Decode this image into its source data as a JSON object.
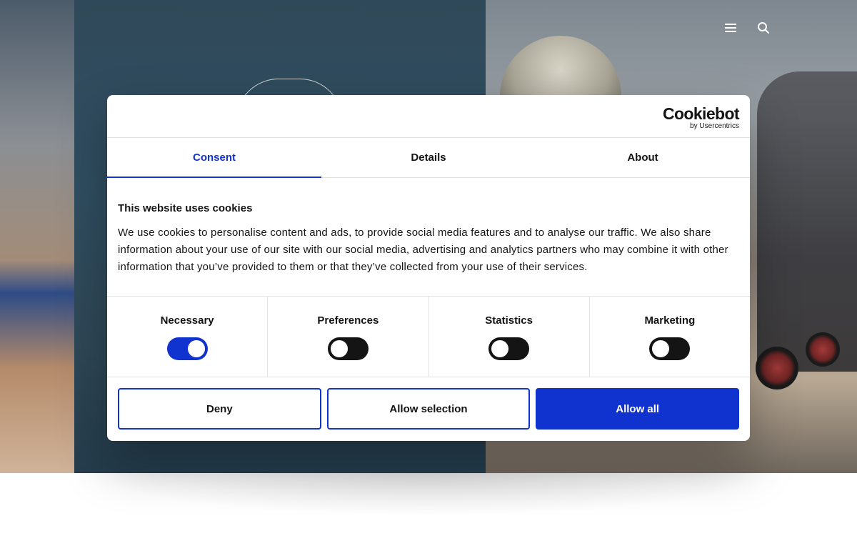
{
  "header": {
    "icons": [
      "menu-icon",
      "search-icon"
    ]
  },
  "dialog": {
    "brand": {
      "name": "Cookiebot",
      "sub": "by Usercentrics"
    },
    "tabs": [
      {
        "label": "Consent",
        "active": true
      },
      {
        "label": "Details",
        "active": false
      },
      {
        "label": "About",
        "active": false
      }
    ],
    "title": "This website uses cookies",
    "body": "We use cookies to personalise content and ads, to provide social media features and to analyse our traffic. We also share information about your use of our site with our social media, advertising and analytics partners who may combine it with other information that you’ve provided to them or that they’ve collected from your use of their services.",
    "categories": [
      {
        "label": "Necessary",
        "enabled": true
      },
      {
        "label": "Preferences",
        "enabled": false
      },
      {
        "label": "Statistics",
        "enabled": false
      },
      {
        "label": "Marketing",
        "enabled": false
      }
    ],
    "buttons": {
      "deny": "Deny",
      "allow_selection": "Allow selection",
      "allow_all": "Allow all"
    }
  },
  "colors": {
    "accent": "#1032cf",
    "text": "#141414",
    "toggle_off": "#141414"
  }
}
